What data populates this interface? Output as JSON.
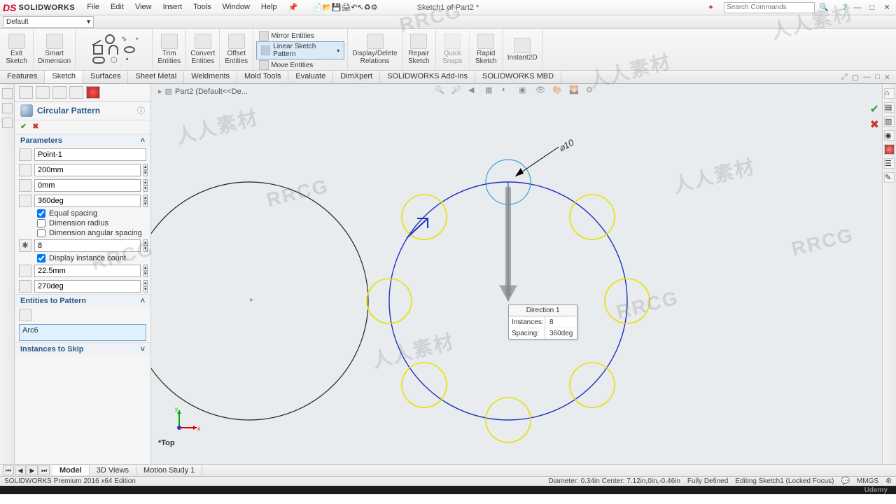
{
  "app": {
    "name": "SOLIDWORKS",
    "doc_title": "Sketch1 of Part2 *",
    "search_placeholder": "Search Commands"
  },
  "menu": {
    "file": "File",
    "edit": "Edit",
    "view": "View",
    "insert": "Insert",
    "tools": "Tools",
    "window": "Window",
    "help": "Help"
  },
  "default_bar": {
    "label": "Default"
  },
  "ribbon": {
    "exit_sketch": "Exit\nSketch",
    "smart_dim": "Smart\nDimension",
    "trim": "Trim\nEntities",
    "convert": "Convert\nEntities",
    "offset": "Offset\nEntities",
    "mirror": "Mirror Entities",
    "linear": "Linear Sketch Pattern",
    "move": "Move Entities",
    "disp_rel": "Display/Delete\nRelations",
    "repair": "Repair\nSketch",
    "quick_snaps": "Quick\nSnaps",
    "rapid": "Rapid\nSketch",
    "instant2d": "Instant2D"
  },
  "cmdtabs": {
    "features": "Features",
    "sketch": "Sketch",
    "surfaces": "Surfaces",
    "sheetmetal": "Sheet Metal",
    "weldments": "Weldments",
    "moldtools": "Mold Tools",
    "evaluate": "Evaluate",
    "dimxpert": "DimXpert",
    "addins": "SOLIDWORKS Add-Ins",
    "mbd": "SOLIDWORKS MBD"
  },
  "crumb": {
    "part": "Part2  (Default<<De..."
  },
  "pmgr": {
    "title": "Circular Pattern",
    "sec_params": "Parameters",
    "center": "Point-1",
    "radius": "200mm",
    "arc_offset": "0mm",
    "angle": "360deg",
    "chk_equal": "Equal spacing",
    "chk_dimrad": "Dimension radius",
    "chk_dimang": "Dimension angular spacing",
    "instances": "8",
    "chk_dispcount": "Display instance count",
    "seed_rad": "22.5mm",
    "seed_ang": "270deg",
    "sec_entities": "Entities to Pattern",
    "entities_val": "Arc6",
    "sec_skip": "Instances to Skip"
  },
  "callout": {
    "head": "Direction 1",
    "instances_lbl": "Instances:",
    "instances_val": "8",
    "spacing_lbl": "Spacing:",
    "spacing_val": "360deg"
  },
  "dim": {
    "phi10": "⌀10"
  },
  "top_label": "*Top",
  "bottabs": {
    "model": "Model",
    "views3d": "3D Views",
    "motion": "Motion Study 1"
  },
  "status": {
    "edition": "SOLIDWORKS Premium 2016 x64 Edition",
    "diam": "Diameter: 0.34in  Center: 7.12in,0in,-0.46in",
    "defined": "Fully Defined",
    "editing": "Editing Sketch1 (Locked Focus)",
    "units": "MMGS"
  },
  "watermark": {
    "rrcg": "RRCG",
    "cn": "人人素材"
  },
  "icons": {
    "search": "🔍",
    "help": "?",
    "min": "—",
    "max": "□",
    "close": "✕",
    "new": "📄",
    "open": "📂",
    "save": "💾",
    "print": "🖨",
    "undo": "↶",
    "select": "↖",
    "rebuild": "♻",
    "options": "⚙"
  }
}
